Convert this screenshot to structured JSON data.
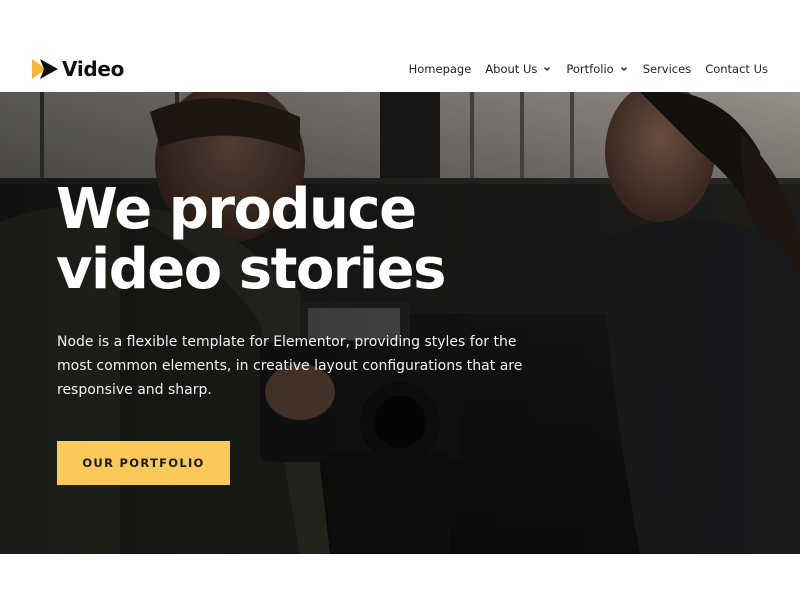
{
  "brand": {
    "name": "Video",
    "logo_icon": "play-arrow-icon",
    "logo_colors": [
      "#f7b733",
      "#111111"
    ]
  },
  "nav": {
    "items": [
      {
        "label": "Homepage",
        "has_dropdown": false
      },
      {
        "label": "About Us",
        "has_dropdown": true
      },
      {
        "label": "Portfolio",
        "has_dropdown": true
      },
      {
        "label": "Services",
        "has_dropdown": false
      },
      {
        "label": "Contact Us",
        "has_dropdown": false
      }
    ]
  },
  "hero": {
    "title_line1": "We produce",
    "title_line2": "video stories",
    "description": "Node is a flexible template for Elementor, providing styles for the most common elements, in creative layout configurations that are responsive and sharp.",
    "cta_label": "OUR PORTFOLIO",
    "background_image": "film-crew-with-camera-photo"
  },
  "colors": {
    "accent": "#fbc85a",
    "hero_overlay": "#1b1a18",
    "text_dark": "#111111",
    "text_light": "#ffffff"
  }
}
